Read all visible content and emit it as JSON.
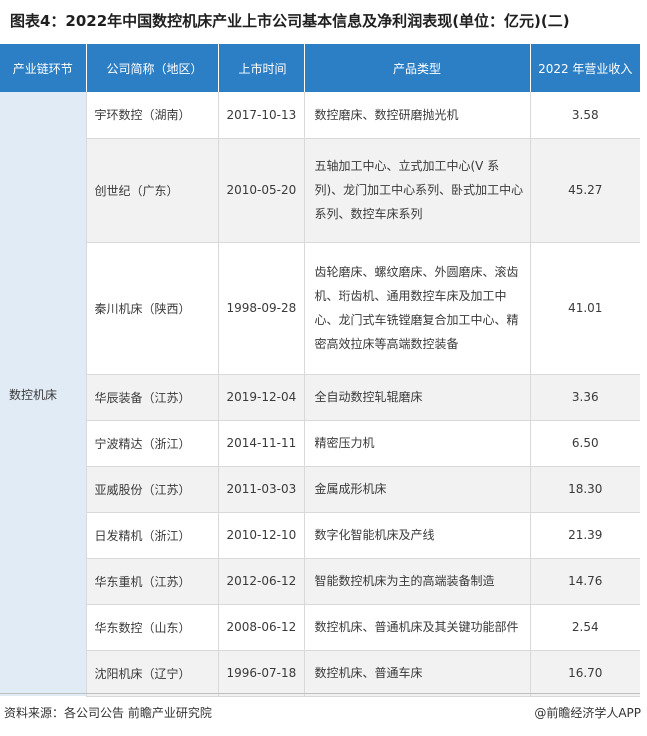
{
  "title": "图表4：2022年中国数控机床产业上市公司基本信息及净利润表现(单位：亿元)(二)",
  "table": {
    "headers": [
      "产业链环节",
      "公司简称（地区）",
      "上市时间",
      "产品类型",
      "2022 年营业收入"
    ],
    "segment": "数控机床",
    "rows": [
      {
        "company": "宇环数控（湖南）",
        "date": "2017-10-13",
        "product": "数控磨床、数控研磨抛光机",
        "revenue": "3.58"
      },
      {
        "company": "创世纪（广东）",
        "date": "2010-05-20",
        "product": "五轴加工中心、立式加工中心(V 系列)、龙门加工中心系列、卧式加工中心系列、数控车床系列",
        "revenue": "45.27"
      },
      {
        "company": "秦川机床（陕西）",
        "date": "1998-09-28",
        "product": "齿轮磨床、螺纹磨床、外圆磨床、滚齿机、珩齿机、通用数控车床及加工中心、龙门式车铣镗磨复合加工中心、精密高效拉床等高端数控装备",
        "revenue": "41.01"
      },
      {
        "company": "华辰装备（江苏）",
        "date": "2019-12-04",
        "product": "全自动数控轧辊磨床",
        "revenue": "3.36"
      },
      {
        "company": "宁波精达（浙江）",
        "date": "2014-11-11",
        "product": "精密压力机",
        "revenue": "6.50"
      },
      {
        "company": "亚威股份（江苏）",
        "date": "2011-03-03",
        "product": "金属成形机床",
        "revenue": "18.30"
      },
      {
        "company": "日发精机（浙江）",
        "date": "2010-12-10",
        "product": "数字化智能机床及产线",
        "revenue": "21.39"
      },
      {
        "company": "华东重机（江苏）",
        "date": "2012-06-12",
        "product": "智能数控机床为主的高端装备制造",
        "revenue": "14.76"
      },
      {
        "company": "华东数控（山东）",
        "date": "2008-06-12",
        "product": "数控机床、普通机床及其关键功能部件",
        "revenue": "2.54"
      },
      {
        "company": "沈阳机床（辽宁）",
        "date": "1996-07-18",
        "product": "数控机床、普通车床",
        "revenue": "16.70"
      }
    ]
  },
  "footer": {
    "source": "资料来源：各公司公告 前瞻产业研究院",
    "brand": "@前瞻经济学人APP"
  },
  "colors": {
    "header_bg": "#2d7fc5",
    "segment_bg": "#e1ebf6",
    "stripe": "#f2f2f2"
  }
}
